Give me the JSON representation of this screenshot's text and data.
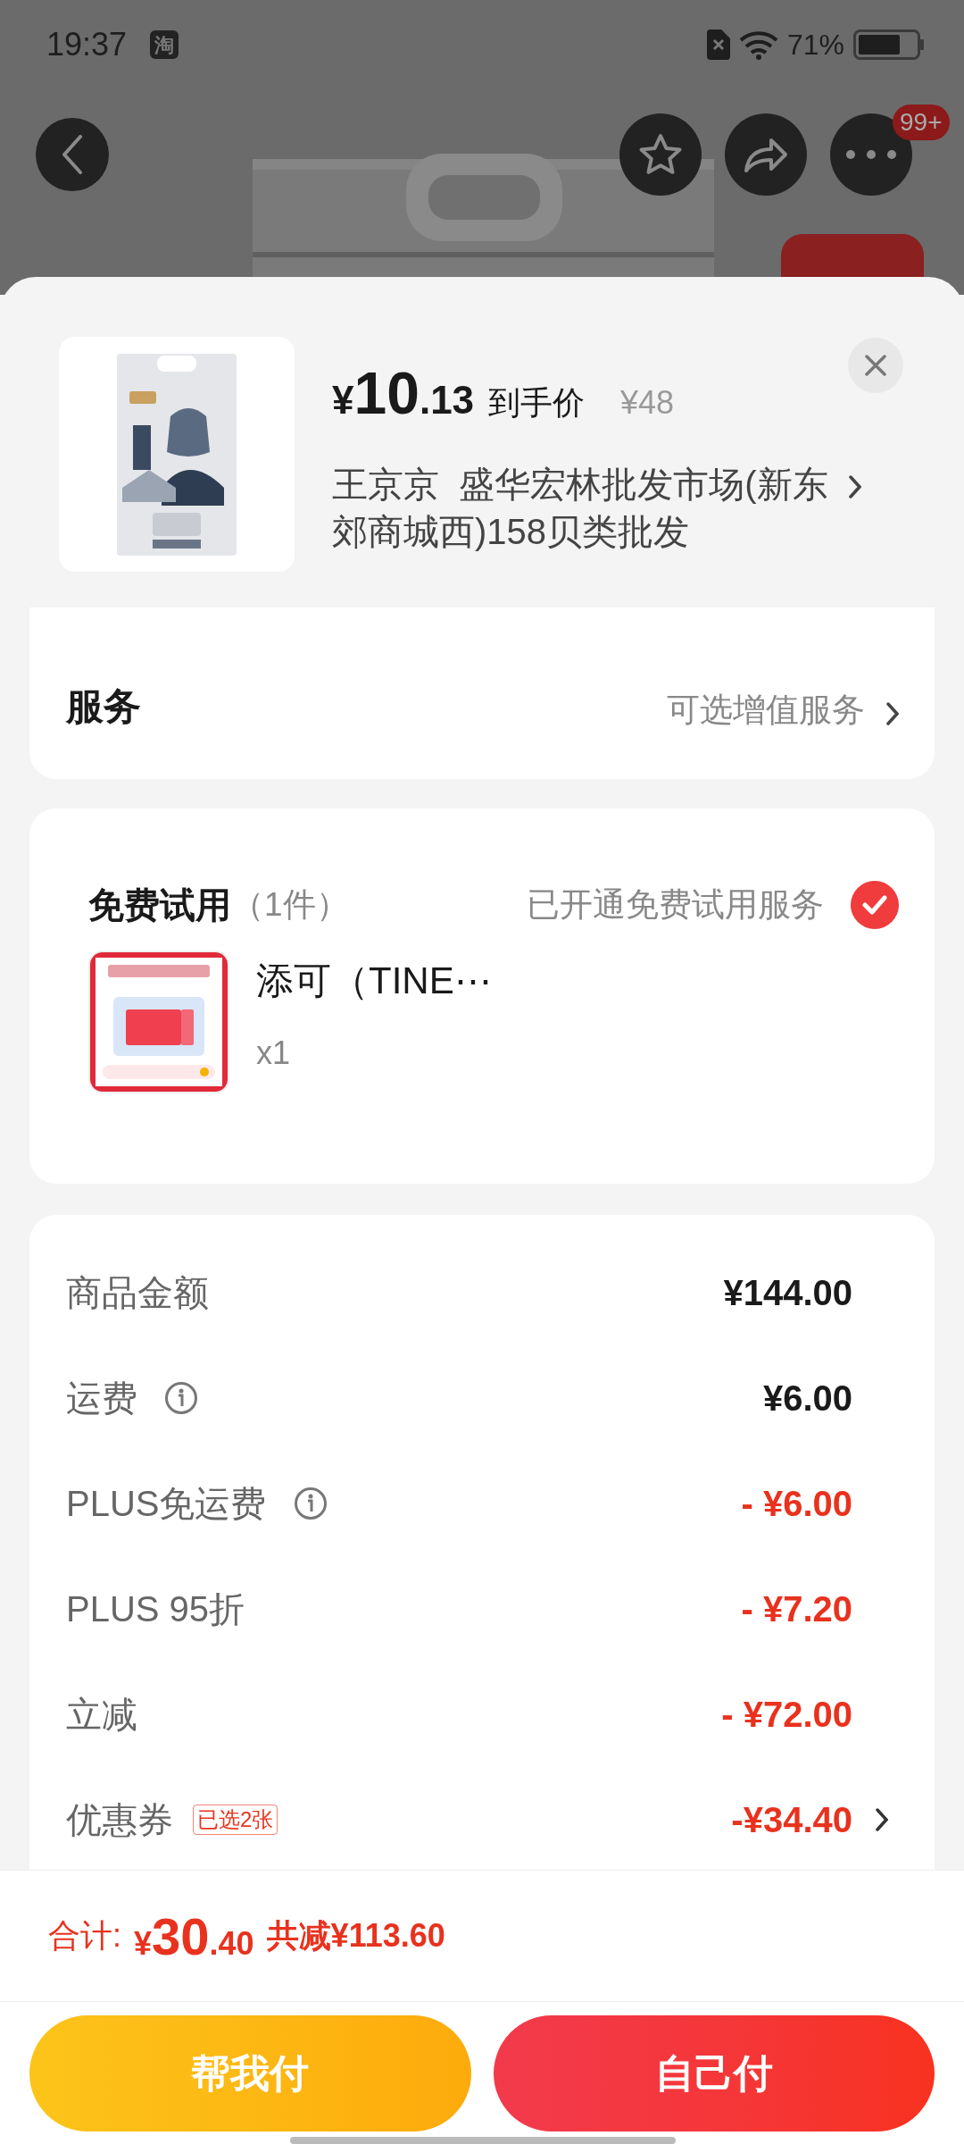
{
  "status_bar": {
    "time": "19:37",
    "app_badge": "淘",
    "battery": "71%"
  },
  "header": {
    "more_badge": "99+"
  },
  "product": {
    "currency": "¥",
    "price_integer": "10",
    "price_decimal": ".13",
    "price_label": "到手价",
    "original_price": "¥48",
    "shop": "王京京  盛华宏林批发市场(新东郊商城西)158贝类批发"
  },
  "service": {
    "label": "服务",
    "value": "可选增值服务"
  },
  "free_trial": {
    "title": "免费试用",
    "count": "（1件）",
    "status": "已开通免费试用服务",
    "checked": true,
    "item": {
      "name": "添可（TINE⋯",
      "quantity": "x1"
    }
  },
  "summary": [
    {
      "label": "商品金额",
      "info": false,
      "amount": "¥144.00",
      "kind": "charge",
      "chevron": false
    },
    {
      "label": "运费",
      "info": true,
      "amount": "¥6.00",
      "kind": "charge",
      "chevron": false
    },
    {
      "label": "PLUS免运费",
      "info": true,
      "amount": "- ¥6.00",
      "kind": "discount",
      "chevron": false
    },
    {
      "label": "PLUS 95折",
      "info": false,
      "amount": "- ¥7.20",
      "kind": "discount",
      "chevron": false
    },
    {
      "label": "立减",
      "info": false,
      "amount": "- ¥72.00",
      "kind": "discount",
      "chevron": false
    },
    {
      "label": "优惠券",
      "info": false,
      "tag": "已选2张",
      "amount": "-¥34.40",
      "kind": "discount",
      "chevron": true
    }
  ],
  "total": {
    "label": "合计:",
    "currency": "¥",
    "integer": "30",
    "decimal": ".40",
    "saved": "共减¥113.60"
  },
  "buttons": [
    {
      "label": "帮我付",
      "kind": "secondary"
    },
    {
      "label": "自己付",
      "kind": "primary"
    }
  ]
}
